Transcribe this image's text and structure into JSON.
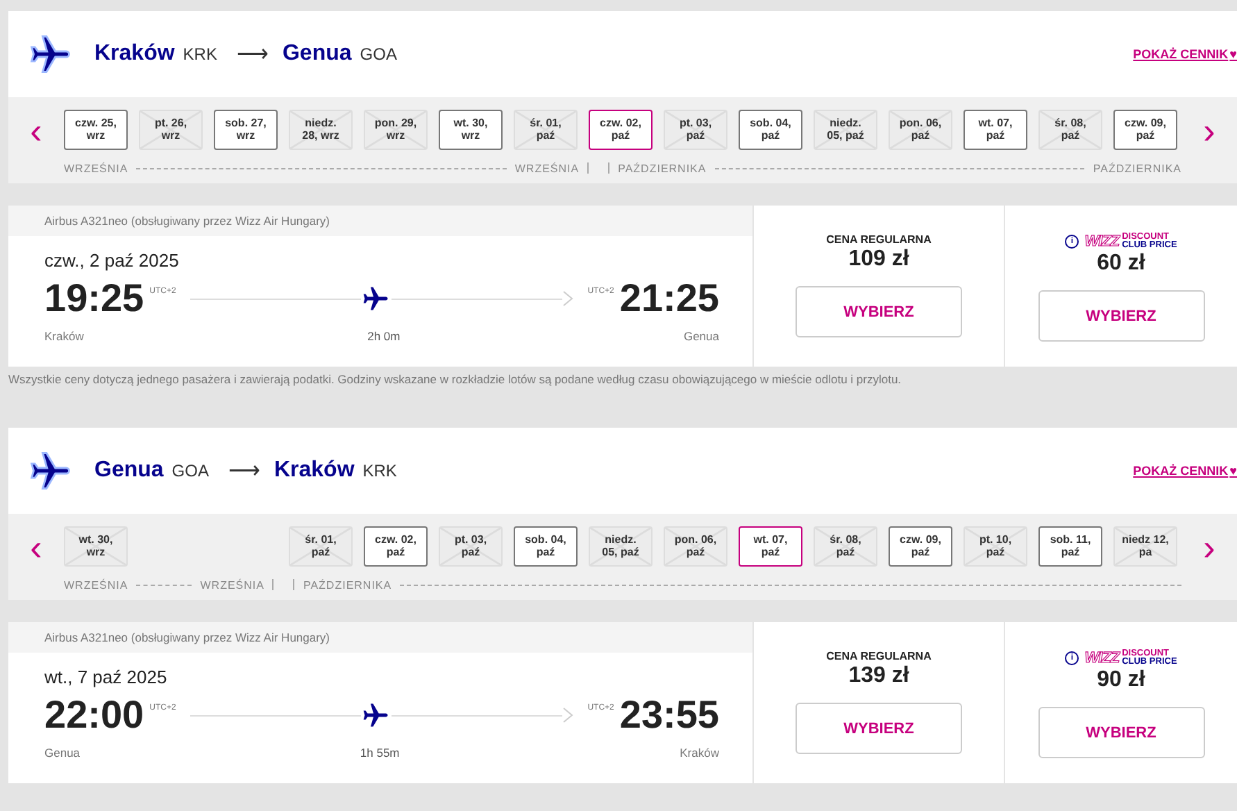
{
  "legs": [
    {
      "route": {
        "from_city": "Kraków",
        "from_code": "KRK",
        "arrow": "⟶",
        "to_city": "Genua",
        "to_code": "GOA"
      },
      "price_link": "POKAŻ CENNIK",
      "heart": "♥",
      "prev": "‹",
      "next": "›",
      "dates": [
        {
          "kind": "date",
          "label": "czw. 25, wrz",
          "available": true,
          "selected": false
        },
        {
          "kind": "date",
          "label": "pt. 26, wrz",
          "available": false,
          "selected": false
        },
        {
          "kind": "date",
          "label": "sob. 27, wrz",
          "available": true,
          "selected": false
        },
        {
          "kind": "date",
          "label": "niedz. 28, wrz",
          "available": false,
          "selected": false
        },
        {
          "kind": "date",
          "label": "pon. 29, wrz",
          "available": false,
          "selected": false
        },
        {
          "kind": "date",
          "label": "wt. 30, wrz",
          "available": true,
          "selected": false
        },
        {
          "kind": "date",
          "label": "śr. 01, paź",
          "available": false,
          "selected": false
        },
        {
          "kind": "date",
          "label": "czw. 02, paź",
          "available": true,
          "selected": true
        },
        {
          "kind": "date",
          "label": "pt. 03, paź",
          "available": false,
          "selected": false
        },
        {
          "kind": "date",
          "label": "sob. 04, paź",
          "available": true,
          "selected": false
        },
        {
          "kind": "date",
          "label": "niedz. 05, paź",
          "available": false,
          "selected": false
        },
        {
          "kind": "date",
          "label": "pon. 06, paź",
          "available": false,
          "selected": false
        },
        {
          "kind": "date",
          "label": "wt. 07, paź",
          "available": true,
          "selected": false
        },
        {
          "kind": "date",
          "label": "śr. 08, paź",
          "available": false,
          "selected": false
        },
        {
          "kind": "date",
          "label": "czw. 09, paź",
          "available": true,
          "selected": false
        }
      ],
      "months": [
        {
          "kind": "label",
          "text": "WRZEŚNIA"
        },
        {
          "kind": "line"
        },
        {
          "kind": "label",
          "text": "WRZEŚNIA"
        },
        {
          "kind": "divider"
        },
        {
          "kind": "label",
          "text": "PAŹDZIERNIKA"
        },
        {
          "kind": "line"
        },
        {
          "kind": "label",
          "text": "PAŹDZIERNIKA"
        }
      ],
      "flight": {
        "aircraft": "Airbus A321neo (obsługiwany przez Wizz Air Hungary)",
        "date": "czw., 2 paź 2025",
        "dep_time": "19:25",
        "dep_tz": "UTC+2",
        "arr_time": "21:25",
        "arr_tz": "UTC+2",
        "duration": "2h 0m",
        "dep_city": "Kraków",
        "arr_city": "Genua",
        "regular": {
          "label": "CENA REGULARNA",
          "price": "109 zł",
          "button": "WYBIERZ"
        },
        "club": {
          "info": "i",
          "logo": "WIZZ",
          "logo_line1": "DISCOUNT",
          "logo_line2": "CLUB PRICE",
          "price": "60 zł",
          "button": "WYBIERZ"
        }
      },
      "note": "Wszystkie ceny dotyczą jednego pasażera i zawierają podatki. Godziny wskazane w rozkładzie lotów są podane według czasu obowiązującego w mieście odlotu i przylotu."
    },
    {
      "route": {
        "from_city": "Genua",
        "from_code": "GOA",
        "arrow": "⟶",
        "to_city": "Kraków",
        "to_code": "KRK"
      },
      "price_link": "POKAŻ CENNIK",
      "heart": "♥",
      "prev": "‹",
      "next": "›",
      "dates": [
        {
          "kind": "date",
          "label": "wt. 30, wrz",
          "available": false,
          "selected": false
        },
        {
          "kind": "blank"
        },
        {
          "kind": "blank"
        },
        {
          "kind": "date",
          "label": "śr. 01, paź",
          "available": false,
          "selected": false
        },
        {
          "kind": "date",
          "label": "czw. 02, paź",
          "available": true,
          "selected": false
        },
        {
          "kind": "date",
          "label": "pt. 03, paź",
          "available": false,
          "selected": false
        },
        {
          "kind": "date",
          "label": "sob. 04, paź",
          "available": true,
          "selected": false
        },
        {
          "kind": "date",
          "label": "niedz. 05, paź",
          "available": false,
          "selected": false
        },
        {
          "kind": "date",
          "label": "pon. 06, paź",
          "available": false,
          "selected": false
        },
        {
          "kind": "date",
          "label": "wt. 07, paź",
          "available": true,
          "selected": true
        },
        {
          "kind": "date",
          "label": "śr. 08, paź",
          "available": false,
          "selected": false
        },
        {
          "kind": "date",
          "label": "czw. 09, paź",
          "available": true,
          "selected": false
        },
        {
          "kind": "date",
          "label": "pt. 10, paź",
          "available": false,
          "selected": false
        },
        {
          "kind": "date",
          "label": "sob. 11, paź",
          "available": true,
          "selected": false
        },
        {
          "kind": "date",
          "label": "niedz 12, pa",
          "available": false,
          "selected": false
        }
      ],
      "months": [
        {
          "kind": "label",
          "text": "WRZEŚNIA"
        },
        {
          "kind": "short"
        },
        {
          "kind": "label",
          "text": "WRZEŚNIA"
        },
        {
          "kind": "divider"
        },
        {
          "kind": "label",
          "text": "PAŹDZIERNIKA"
        },
        {
          "kind": "line"
        }
      ],
      "flight": {
        "aircraft": "Airbus A321neo (obsługiwany przez Wizz Air Hungary)",
        "date": "wt., 7 paź 2025",
        "dep_time": "22:00",
        "dep_tz": "UTC+2",
        "arr_time": "23:55",
        "arr_tz": "UTC+2",
        "duration": "1h 55m",
        "dep_city": "Genua",
        "arr_city": "Kraków",
        "regular": {
          "label": "CENA REGULARNA",
          "price": "139 zł",
          "button": "WYBIERZ"
        },
        "club": {
          "info": "i",
          "logo": "WIZZ",
          "logo_line1": "DISCOUNT",
          "logo_line2": "CLUB PRICE",
          "price": "90 zł",
          "button": "WYBIERZ"
        }
      }
    }
  ]
}
